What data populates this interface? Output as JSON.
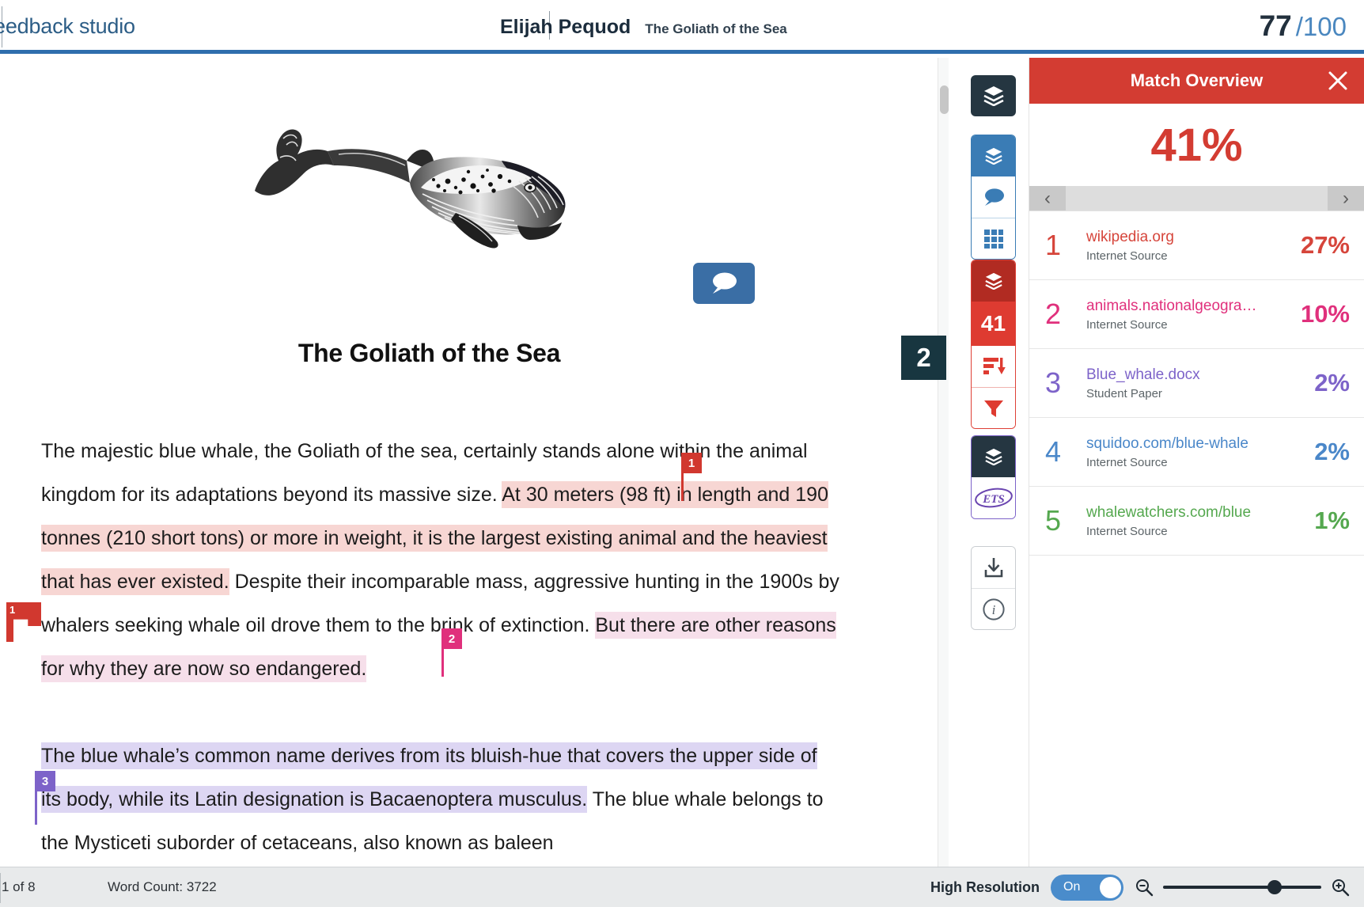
{
  "header": {
    "brand": "eedback studio",
    "student_name": "Elijah Pequod",
    "paper_title": "The Goliath of the Sea",
    "score": "77",
    "score_total": "/100"
  },
  "document": {
    "title": "The Goliath of the Sea",
    "illustration": "blue-whale-engraving",
    "paragraph1": {
      "seg_plain_1": "The majestic blue whale, the Goliath of the sea, certainly stands alone within the animal kingdom for its adaptations beyond its massive size. ",
      "seg_hl_red": "At 30 meters (98 ft) in length and 190 tonnes (210 short tons) or more in weight, it is the largest existing animal and the heaviest that has ever existed.",
      "seg_plain_2": " Despite their incomparable mass, aggressive hunting in the 1900s by whalers seeking whale oil drove them to the brink of extinction. ",
      "seg_hl_pink": "But there are other reasons for why they are now so endangered."
    },
    "paragraph2": {
      "seg_hl_purple": "The blue whale’s common name derives from its bluish-hue that covers the upper side of its body, while its Latin designation is Bacaenoptera musculus.",
      "seg_plain": " The blue whale belongs to the Mysticeti suborder of cetaceans, also known as baleen"
    },
    "markers": {
      "badge1": "1",
      "badge2": "2",
      "badge3": "3",
      "flag_label": "1",
      "page_badge": "2"
    }
  },
  "toolbar": {
    "similarity_count": "41",
    "items": [
      {
        "name": "layers-stack-icon",
        "label": "Layers"
      },
      {
        "name": "comment-bubble-icon",
        "label": "Comments"
      },
      {
        "name": "grid-rubric-icon",
        "label": "Rubric"
      },
      {
        "name": "similarity-score-badge",
        "label": "41"
      },
      {
        "name": "sort-matches-icon",
        "label": "Sort matches"
      },
      {
        "name": "filter-funnel-icon",
        "label": "Filters and settings"
      },
      {
        "name": "ets-logo-icon",
        "label": "ETS e-rater"
      },
      {
        "name": "download-icon",
        "label": "Download"
      },
      {
        "name": "info-icon",
        "label": "Information"
      }
    ]
  },
  "sidebar": {
    "title": "Match Overview",
    "close_label": "✕",
    "overall_percent": "41%",
    "nav_prev": "‹",
    "nav_next": "›",
    "sources": [
      {
        "rank": "1",
        "name": "wikipedia.org",
        "type": "Internet Source",
        "percent": "27%",
        "color": "#d6453b"
      },
      {
        "rank": "2",
        "name": "animals.nationalgeogra…",
        "type": "Internet Source",
        "percent": "10%",
        "color": "#e0307c"
      },
      {
        "rank": "3",
        "name": "Blue_whale.docx",
        "type": "Student Paper",
        "percent": "2%",
        "color": "#7d63c9"
      },
      {
        "rank": "4",
        "name": "squidoo.com/blue-whale",
        "type": "Internet Source",
        "percent": "2%",
        "color": "#4a87c9"
      },
      {
        "rank": "5",
        "name": "whalewatchers.com/blue",
        "type": "Internet Source",
        "percent": "1%",
        "color": "#55a84f"
      }
    ]
  },
  "statusbar": {
    "page_info": "1 of 8",
    "word_count": "Word Count: 3722",
    "high_resolution_label": "High Resolution",
    "toggle_state": "On"
  }
}
